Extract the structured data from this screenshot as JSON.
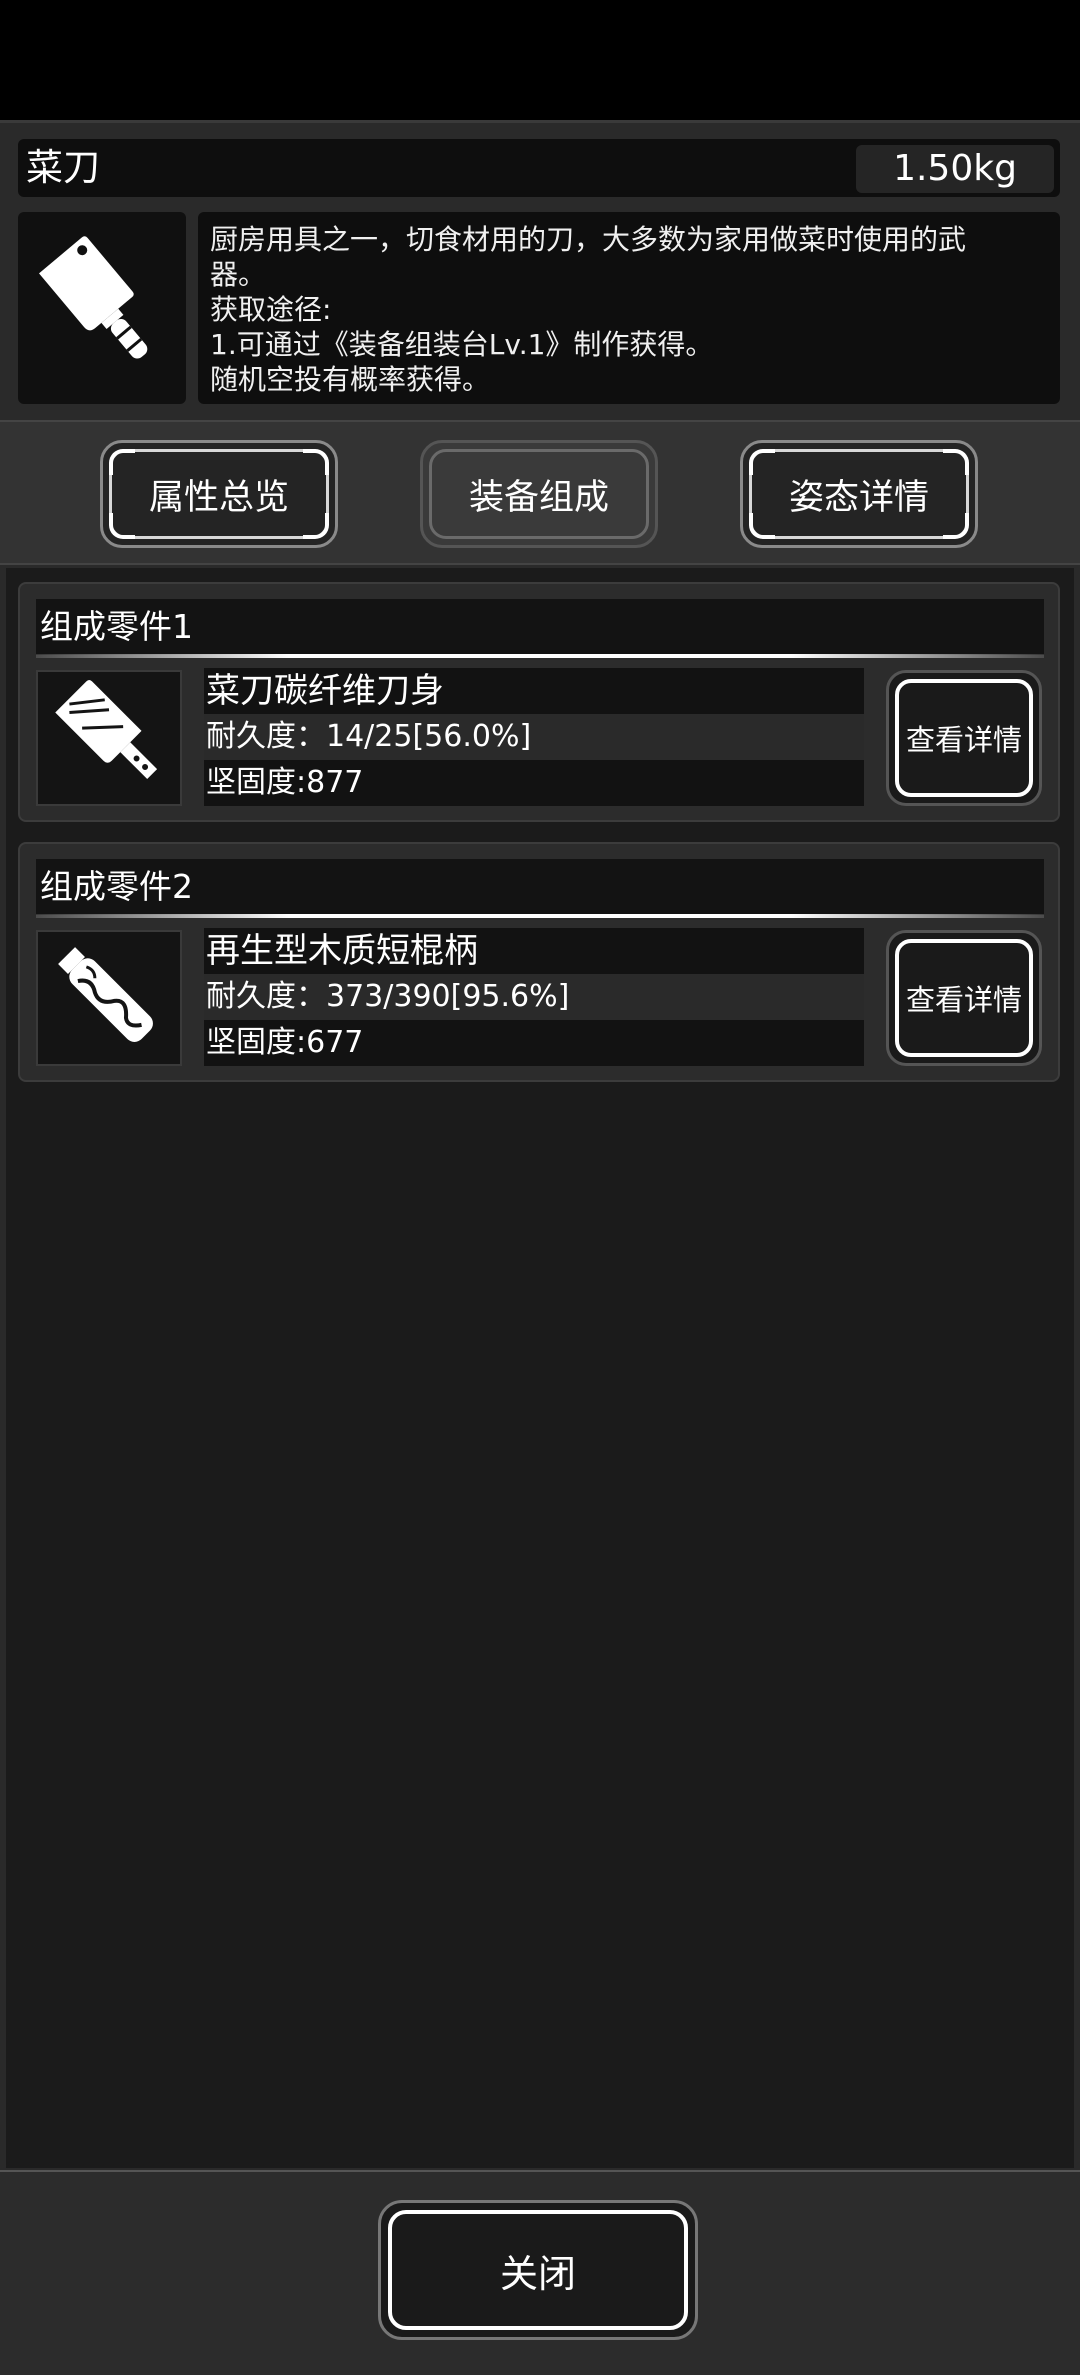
{
  "item": {
    "name": "菜刀",
    "weight": "1.50kg",
    "icon": "cleaver-icon",
    "description_lines": [
      "厨房用具之一，切食材用的刀，大多数为家用做菜时使用的武",
      "器。",
      "获取途径:",
      "1.可通过《装备组装台Lv.1》制作获得。",
      "随机空投有概率获得。"
    ]
  },
  "tabs": [
    {
      "label": "属性总览",
      "active": false
    },
    {
      "label": "装备组成",
      "active": true
    },
    {
      "label": "姿态详情",
      "active": false
    }
  ],
  "parts": [
    {
      "header": "组成零件1",
      "icon": "blade-icon",
      "name": "菜刀碳纤维刀身",
      "durability": "耐久度：14/25[56.0%]",
      "hardness": "坚固度:877",
      "button": "查看详情"
    },
    {
      "header": "组成零件2",
      "icon": "wooden-handle-icon",
      "name": "再生型木质短棍柄",
      "durability": "耐久度：373/390[95.6%]",
      "hardness": "坚固度:677",
      "button": "查看详情"
    }
  ],
  "close_label": "关闭"
}
